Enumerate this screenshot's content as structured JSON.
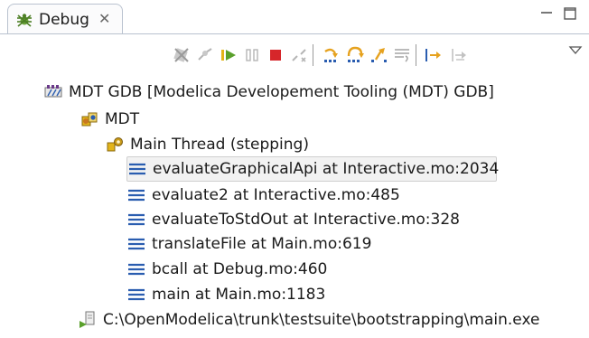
{
  "view": {
    "tab_label": "Debug",
    "tab_icon": "debug-bug-icon",
    "close_icon": "close-tab-icon"
  },
  "toolbar": {
    "items": [
      "remove-all-terminated-icon",
      "connect-icon",
      "resume-icon",
      "suspend-icon",
      "terminate-icon",
      "disconnect-icon",
      "step-into-icon",
      "step-over-icon",
      "step-return-icon",
      "drop-to-frame-icon",
      "use-step-filters-icon",
      "instruction-stepping-icon",
      "view-menu-icon"
    ],
    "colors": {
      "resume": "#5aa02c",
      "terminate": "#d6262a",
      "step": "#e6a21f",
      "disabled": "#b5b5b5"
    }
  },
  "tree": {
    "launch": "MDT GDB [Modelica Developement Tooling (MDT) GDB]",
    "target": "MDT",
    "thread": "Main Thread (stepping)",
    "frames": [
      "evaluateGraphicalApi at Interactive.mo:2034",
      "evaluate2 at Interactive.mo:485",
      "evaluateToStdOut at Interactive.mo:328",
      "translateFile at Main.mo:619",
      "bcall at Debug.mo:460",
      "main at Main.mo:1183"
    ],
    "process": "C:\\OpenModelica\\trunk\\testsuite\\bootstrapping\\main.exe"
  }
}
